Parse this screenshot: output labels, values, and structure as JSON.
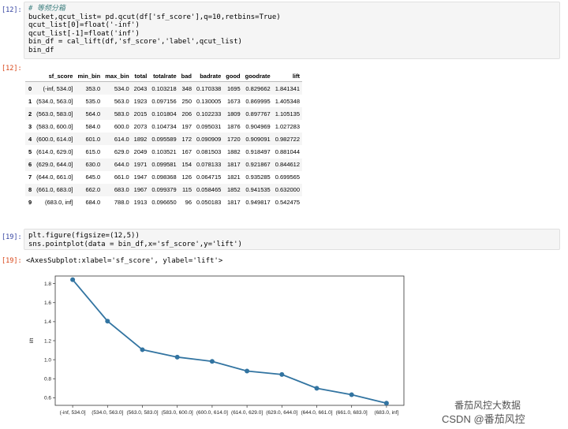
{
  "cell12_in": {
    "prompt": "[12]:",
    "lines": [
      "# 等频分箱",
      "bucket,qcut_list= pd.qcut(df['sf_score'],q=10,retbins=True)",
      "qcut_list[0]=float('-inf')",
      "qcut_list[-1]=float('inf')",
      "bin_df = cal_lift(df,'sf_score','label',qcut_list)",
      "bin_df"
    ]
  },
  "cell12_out": {
    "prompt": "[12]:",
    "columns": [
      "sf_score",
      "min_bin",
      "max_bin",
      "total",
      "totalrate",
      "bad",
      "badrate",
      "good",
      "goodrate",
      "lift"
    ],
    "rows": [
      [
        "0",
        "(-inf, 534.0]",
        "353.0",
        "534.0",
        "2043",
        "0.103218",
        "348",
        "0.170338",
        "1695",
        "0.829662",
        "1.841341"
      ],
      [
        "1",
        "(534.0, 563.0]",
        "535.0",
        "563.0",
        "1923",
        "0.097156",
        "250",
        "0.130005",
        "1673",
        "0.869995",
        "1.405348"
      ],
      [
        "2",
        "(563.0, 583.0]",
        "564.0",
        "583.0",
        "2015",
        "0.101804",
        "206",
        "0.102233",
        "1809",
        "0.897767",
        "1.105135"
      ],
      [
        "3",
        "(583.0, 600.0]",
        "584.0",
        "600.0",
        "2073",
        "0.104734",
        "197",
        "0.095031",
        "1876",
        "0.904969",
        "1.027283"
      ],
      [
        "4",
        "(600.0, 614.0]",
        "601.0",
        "614.0",
        "1892",
        "0.095589",
        "172",
        "0.090909",
        "1720",
        "0.909091",
        "0.982722"
      ],
      [
        "5",
        "(614.0, 629.0]",
        "615.0",
        "629.0",
        "2049",
        "0.103521",
        "167",
        "0.081503",
        "1882",
        "0.918497",
        "0.881044"
      ],
      [
        "6",
        "(629.0, 644.0]",
        "630.0",
        "644.0",
        "1971",
        "0.099581",
        "154",
        "0.078133",
        "1817",
        "0.921867",
        "0.844612"
      ],
      [
        "7",
        "(644.0, 661.0]",
        "645.0",
        "661.0",
        "1947",
        "0.098368",
        "126",
        "0.064715",
        "1821",
        "0.935285",
        "0.699565"
      ],
      [
        "8",
        "(661.0, 683.0]",
        "662.0",
        "683.0",
        "1967",
        "0.099379",
        "115",
        "0.058465",
        "1852",
        "0.941535",
        "0.632000"
      ],
      [
        "9",
        "(683.0, inf]",
        "684.0",
        "788.0",
        "1913",
        "0.096650",
        "96",
        "0.050183",
        "1817",
        "0.949817",
        "0.542475"
      ]
    ]
  },
  "cell19_in": {
    "prompt": "[19]:",
    "lines": [
      "plt.figure(figsize=(12,5))",
      "sns.pointplot(data = bin_df,x='sf_score',y='lift')"
    ]
  },
  "cell19_out": {
    "prompt": "[19]:",
    "text": "<AxesSubplot:xlabel='sf_score', ylabel='lift'>"
  },
  "chart_data": {
    "type": "line",
    "categories": [
      "(-inf, 534.0]",
      "(534.0, 563.0]",
      "(563.0, 583.0]",
      "(583.0, 600.0]",
      "(600.0, 614.0]",
      "(614.0, 629.0]",
      "(629.0, 644.0]",
      "(644.0, 661.0]",
      "(661.0, 683.0]",
      "(683.0, inf]"
    ],
    "tick_labels": [
      "(-inf, 534.0]",
      "(534.0, 563.0]",
      "(563.0, 583.0]",
      "(583.0, 600.0]",
      "(600.0, 614.0]",
      "(614.0, 629.0]",
      "(629.0, 644.0]",
      "(644.0, 661.0]",
      "(661.0, 683.0]",
      "(683.0, inf]"
    ],
    "values": [
      1.841341,
      1.405348,
      1.105135,
      1.027283,
      0.982722,
      0.881044,
      0.844612,
      0.699565,
      0.632,
      0.542475
    ],
    "ylabel": "lift",
    "xlabel": "",
    "yticks": [
      "0.6",
      "0.8",
      "1.0",
      "1.2",
      "1.4",
      "1.6",
      "1.8"
    ],
    "ylim": [
      0.52,
      1.88
    ],
    "color": "#3274a1",
    "grid": false
  },
  "watermark": {
    "line1": "番茄风控大数据",
    "line2": "CSDN @番茄风控"
  }
}
